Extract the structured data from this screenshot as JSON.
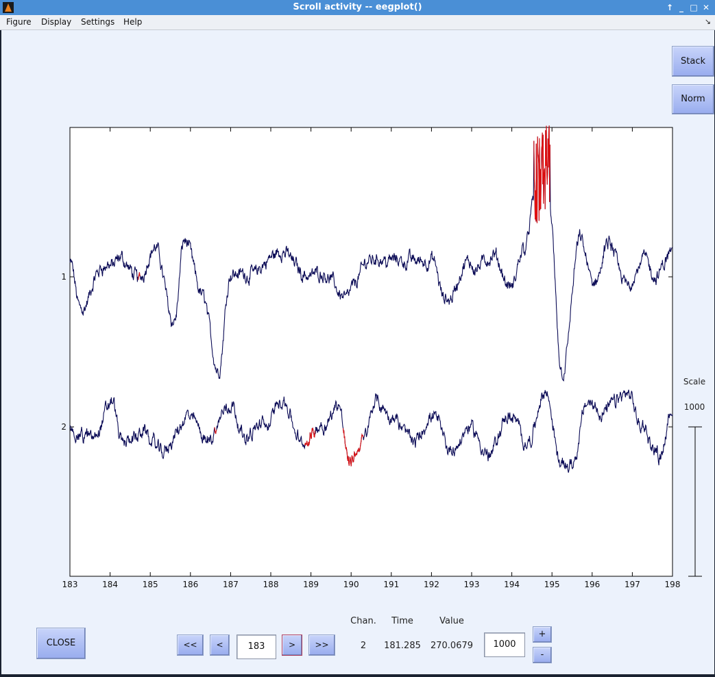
{
  "window": {
    "title": "Scroll activity -- eegplot()",
    "controls": [
      "↑",
      "_",
      "□",
      "✕"
    ]
  },
  "menu": {
    "items": [
      "Figure",
      "Display",
      "Settings",
      "Help"
    ],
    "dock_icon": "↘"
  },
  "side_buttons": {
    "stack": "Stack",
    "norm": "Norm"
  },
  "scale": {
    "label": "Scale",
    "value": "1000"
  },
  "bottom": {
    "close": "CLOSE",
    "first": "<<",
    "prev": "<",
    "time_input": "183",
    "next": ">",
    "last": ">>",
    "chan_header": "Chan.",
    "time_header": "Time",
    "value_header": "Value",
    "chan_value": "2",
    "time_value": "181.285",
    "value_value": "270.0679",
    "scale_input": "1000",
    "plus": "+",
    "minus": "-"
  },
  "chart_data": {
    "type": "line",
    "title": "",
    "xlabel": "",
    "ylabel": "",
    "xlim": [
      183,
      198
    ],
    "x_ticks": [
      "183",
      "184",
      "185",
      "186",
      "187",
      "188",
      "189",
      "190",
      "191",
      "192",
      "193",
      "194",
      "195",
      "196",
      "197",
      "198"
    ],
    "y_ticks": [
      "1",
      "2"
    ],
    "grid": false,
    "series": [
      {
        "name": "1",
        "color": "#0a0a55",
        "keypoints_x": [
          183.0,
          183.25,
          183.9,
          184.3,
          184.7,
          185.1,
          185.6,
          185.85,
          186.3,
          186.7,
          187.0,
          187.5,
          188.3,
          188.9,
          189.3,
          189.8,
          190.6,
          191.3,
          192.0,
          192.35,
          192.9,
          193.5,
          194.0,
          194.3,
          194.55,
          194.9,
          195.25,
          195.7,
          196.05,
          196.4,
          196.85,
          197.3,
          197.6,
          198.0
        ],
        "keypoints_y": [
          20,
          -45,
          15,
          20,
          -5,
          45,
          -60,
          55,
          -30,
          -135,
          10,
          5,
          35,
          5,
          10,
          -25,
          30,
          25,
          25,
          -40,
          15,
          25,
          -20,
          40,
          110,
          120,
          -150,
          50,
          -15,
          45,
          -15,
          30,
          0,
          35
        ]
      },
      {
        "name": "2",
        "color": "#0a0a55",
        "keypoints_x": [
          183.0,
          183.5,
          184.05,
          184.3,
          184.8,
          185.3,
          186.0,
          186.45,
          187.0,
          187.4,
          187.8,
          188.3,
          188.8,
          189.3,
          189.7,
          189.95,
          190.3,
          190.6,
          191.0,
          191.6,
          192.0,
          192.5,
          193.0,
          193.4,
          193.9,
          194.4,
          194.85,
          195.2,
          195.5,
          195.85,
          196.3,
          196.85,
          197.25,
          197.65,
          198.0
        ],
        "keypoints_y": [
          0,
          -15,
          40,
          -20,
          -10,
          -35,
          10,
          -15,
          40,
          -15,
          0,
          40,
          -30,
          5,
          35,
          -45,
          -20,
          35,
          10,
          -15,
          15,
          -35,
          0,
          -40,
          15,
          -20,
          45,
          -50,
          -45,
          35,
          25,
          45,
          -5,
          -40,
          25
        ]
      }
    ],
    "artifact_color": "#e01010",
    "artifacts": [
      {
        "channel": "1",
        "x_range": [
          184.7,
          184.75
        ]
      },
      {
        "channel": "1",
        "x_range": [
          194.55,
          194.95
        ]
      },
      {
        "channel": "2",
        "x_range": [
          186.6,
          186.65
        ]
      },
      {
        "channel": "2",
        "x_range": [
          188.85,
          189.1
        ]
      },
      {
        "channel": "2",
        "x_range": [
          189.8,
          190.3
        ]
      }
    ]
  }
}
